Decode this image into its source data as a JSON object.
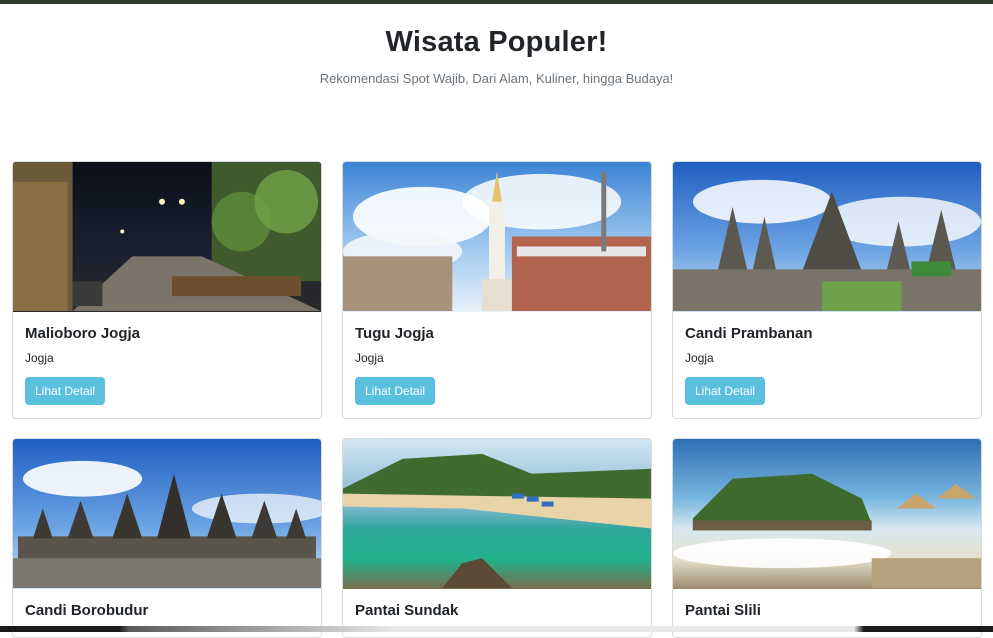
{
  "header": {
    "title": "Wisata Populer!",
    "subtitle": "Rekomendasi Spot Wajib, Dari Alam, Kuliner, hingga Budaya!"
  },
  "cards": [
    {
      "name": "Malioboro Jogja",
      "location": "Jogja",
      "button": "Lihat Detail"
    },
    {
      "name": "Tugu Jogja",
      "location": "Jogja",
      "button": "Lihat Detail"
    },
    {
      "name": "Candi Prambanan",
      "location": "Jogja",
      "button": "Lihat Detail"
    },
    {
      "name": "Candi Borobudur",
      "location": "",
      "button": ""
    },
    {
      "name": "Pantai Sundak",
      "location": "",
      "button": ""
    },
    {
      "name": "Pantai Slili",
      "location": "",
      "button": ""
    }
  ],
  "colors": {
    "button_bg": "#5bc0de",
    "topbar": "#2f3b2f"
  }
}
